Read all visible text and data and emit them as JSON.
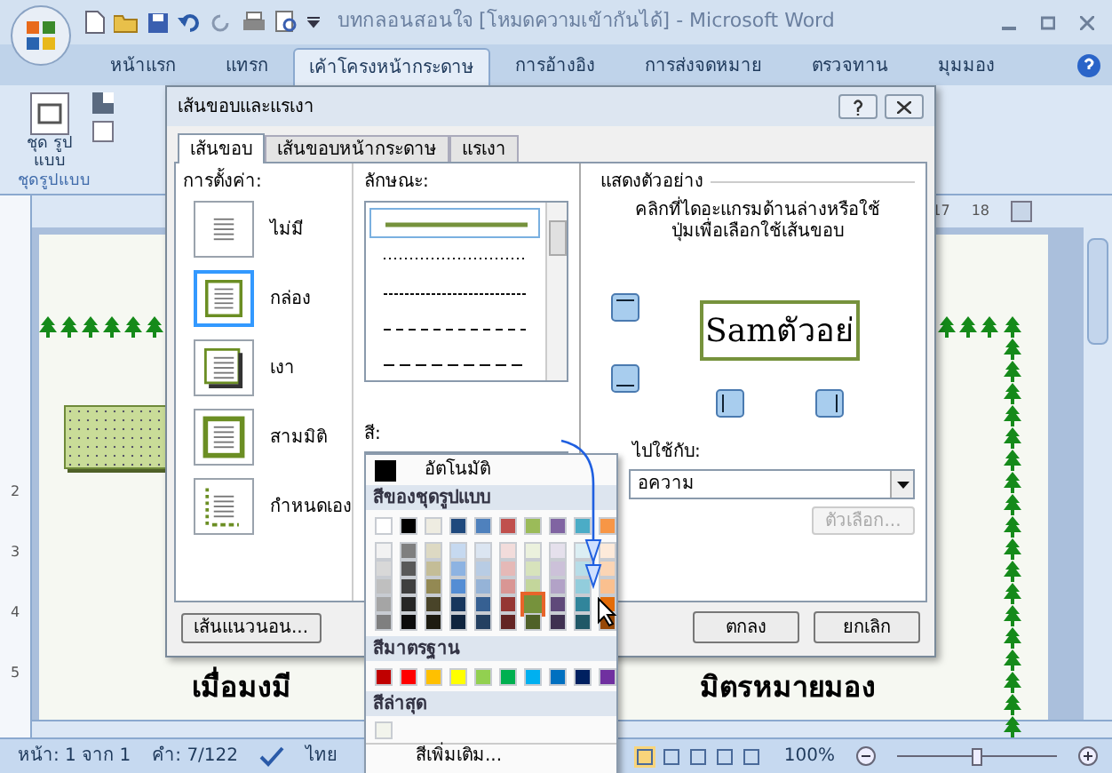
{
  "window": {
    "title": "บทกลอนสอนใจ [โหมดความเข้ากันได้] - Microsoft Word"
  },
  "ribbon_tabs": [
    {
      "label": "หน้าแรก",
      "selected": false
    },
    {
      "label": "แทรก",
      "selected": false
    },
    {
      "label": "เค้าโครงหน้ากระดาษ",
      "selected": true
    },
    {
      "label": "การอ้างอิง",
      "selected": false
    },
    {
      "label": "การส่งจดหมาย",
      "selected": false
    },
    {
      "label": "ตรวจทาน",
      "selected": false
    },
    {
      "label": "มุมมอง",
      "selected": false
    }
  ],
  "ribbon": {
    "theme_button": "ชุด รูปแบบ",
    "group_label": "ชุดรูปแบบ"
  },
  "ruler": {
    "top_numbers": [
      "17",
      "18"
    ],
    "side_numbers": [
      "2",
      "3",
      "4",
      "5"
    ]
  },
  "document": {
    "lines": [
      "เมื่อมงมี",
      "มิตรหมายมอง"
    ]
  },
  "status_bar": {
    "page": "หน้า: 1 จาก 1",
    "words": "คำ: 7/122",
    "language": "ไทย",
    "zoom": "100%",
    "zoom_slider": {
      "level": 0.5
    }
  },
  "dialog": {
    "title": "เส้นขอบและแรเงา",
    "tabs": [
      {
        "label": "เส้นขอบ",
        "selected": true
      },
      {
        "label": "เส้นขอบหน้ากระดาษ",
        "selected": false
      },
      {
        "label": "แรเงา",
        "selected": false
      }
    ],
    "settings_label": "การตั้งค่า:",
    "settings": [
      {
        "kind": "none",
        "label": "ไม่มี",
        "selected": false
      },
      {
        "kind": "box",
        "label": "กล่อง",
        "selected": true
      },
      {
        "kind": "shadow",
        "label": "เงา",
        "selected": false
      },
      {
        "kind": "raised",
        "label": "สามมิติ",
        "selected": false
      },
      {
        "kind": "custom",
        "label": "กำหนดเอง",
        "selected": false
      }
    ],
    "style_label": "ลักษณะ:",
    "styles": [
      {
        "kind": "solid",
        "selected": true
      },
      {
        "kind": "dotted",
        "selected": false
      },
      {
        "kind": "fine-dashed",
        "selected": false
      },
      {
        "kind": "dashed",
        "selected": false
      },
      {
        "kind": "long-dashed",
        "selected": false
      }
    ],
    "color_label": "สี:",
    "color": "#76923c",
    "preview_label": "แสดงตัวอย่าง",
    "preview_hint": "คลิกที่ไดอะแกรมด้านล่างหรือใช้ปุ่มเพื่อเลือกใช้เส้นขอบ",
    "preview_text": "Samตัวอย่",
    "apply_label": "ไปใช้กับ:",
    "apply_value": "อความ",
    "options_button": {
      "label": "ตัวเลือก...",
      "disabled": true
    },
    "horizontal_line_button": "เส้นแนวนอน...",
    "ok_button": "ตกลง",
    "cancel_button": "ยกเลิก"
  },
  "color_menu": {
    "automatic": "อัตโนมัติ",
    "theme_heading": "สีของชุดรูปแบบ",
    "theme_colors": [
      {
        "color": "#ffffff",
        "selected": false,
        "shades": [
          {
            "color": "#f2f2f2",
            "selected": false
          },
          {
            "color": "#d8d8d8",
            "selected": false
          },
          {
            "color": "#bfbfbf",
            "selected": false
          },
          {
            "color": "#a5a5a5",
            "selected": false
          },
          {
            "color": "#7f7f7f",
            "selected": false
          }
        ]
      },
      {
        "color": "#000000",
        "selected": false,
        "shades": [
          {
            "color": "#7f7f7f",
            "selected": false
          },
          {
            "color": "#595959",
            "selected": false
          },
          {
            "color": "#3f3f3f",
            "selected": false
          },
          {
            "color": "#262626",
            "selected": false
          },
          {
            "color": "#0c0c0c",
            "selected": false
          }
        ]
      },
      {
        "color": "#eeece1",
        "selected": false,
        "shades": [
          {
            "color": "#ddd9c3",
            "selected": false
          },
          {
            "color": "#c4bd97",
            "selected": false
          },
          {
            "color": "#938953",
            "selected": false
          },
          {
            "color": "#494429",
            "selected": false
          },
          {
            "color": "#1d1b10",
            "selected": false
          }
        ]
      },
      {
        "color": "#1f497d",
        "selected": false,
        "shades": [
          {
            "color": "#c6d9f0",
            "selected": false
          },
          {
            "color": "#8db3e2",
            "selected": false
          },
          {
            "color": "#548dd4",
            "selected": false
          },
          {
            "color": "#17365d",
            "selected": false
          },
          {
            "color": "#0f243e",
            "selected": false
          }
        ]
      },
      {
        "color": "#4f81bd",
        "selected": false,
        "shades": [
          {
            "color": "#dbe5f1",
            "selected": false
          },
          {
            "color": "#b8cce4",
            "selected": false
          },
          {
            "color": "#95b3d7",
            "selected": false
          },
          {
            "color": "#366092",
            "selected": false
          },
          {
            "color": "#244061",
            "selected": false
          }
        ]
      },
      {
        "color": "#c0504d",
        "selected": false,
        "shades": [
          {
            "color": "#f2dcdb",
            "selected": false
          },
          {
            "color": "#e5b9b7",
            "selected": false
          },
          {
            "color": "#d99694",
            "selected": false
          },
          {
            "color": "#953734",
            "selected": false
          },
          {
            "color": "#632423",
            "selected": false
          }
        ]
      },
      {
        "color": "#9bbb59",
        "selected": false,
        "shades": [
          {
            "color": "#ebf1dd",
            "selected": false
          },
          {
            "color": "#d7e3bc",
            "selected": false
          },
          {
            "color": "#c3d69b",
            "selected": false
          },
          {
            "color": "#76923c",
            "selected": true
          },
          {
            "color": "#4f6128",
            "selected": false
          }
        ]
      },
      {
        "color": "#8064a2",
        "selected": false,
        "shades": [
          {
            "color": "#e5e0ec",
            "selected": false
          },
          {
            "color": "#ccc1d9",
            "selected": false
          },
          {
            "color": "#b2a2c7",
            "selected": false
          },
          {
            "color": "#5f497a",
            "selected": false
          },
          {
            "color": "#3f3151",
            "selected": false
          }
        ]
      },
      {
        "color": "#4bacc6",
        "selected": false,
        "shades": [
          {
            "color": "#dbeef3",
            "selected": false
          },
          {
            "color": "#b7dde8",
            "selected": false
          },
          {
            "color": "#92cddc",
            "selected": false
          },
          {
            "color": "#31859b",
            "selected": false
          },
          {
            "color": "#205867",
            "selected": false
          }
        ]
      },
      {
        "color": "#f79646",
        "selected": false,
        "shades": [
          {
            "color": "#fdeada",
            "selected": false
          },
          {
            "color": "#fbd5b5",
            "selected": false
          },
          {
            "color": "#fac08f",
            "selected": false
          },
          {
            "color": "#e36c09",
            "selected": false
          },
          {
            "color": "#974806",
            "selected": false
          }
        ]
      }
    ],
    "standard_heading": "สีมาตรฐาน",
    "standard_colors": [
      {
        "color": "#c00000"
      },
      {
        "color": "#ff0000"
      },
      {
        "color": "#ffc000"
      },
      {
        "color": "#ffff00"
      },
      {
        "color": "#92d050"
      },
      {
        "color": "#00b050"
      },
      {
        "color": "#00b0f0"
      },
      {
        "color": "#0070c0"
      },
      {
        "color": "#002060"
      },
      {
        "color": "#7030a0"
      }
    ],
    "recent_heading": "สีล่าสุด",
    "recent_colors": [
      {
        "color": "#f2f4ec"
      }
    ],
    "more": "สีเพิ่มเติม..."
  }
}
